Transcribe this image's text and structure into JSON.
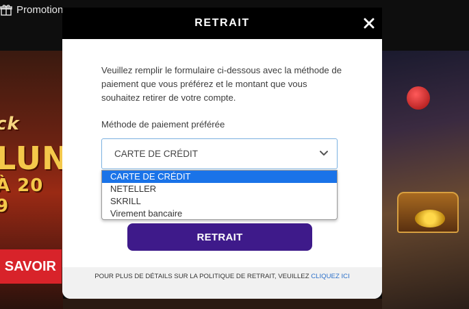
{
  "background": {
    "nav_item": "Promotions",
    "promo_lines": [
      "ck",
      "LUN",
      "À 20 9"
    ],
    "promo_button": "SAVOIR"
  },
  "modal": {
    "title": "RETRAIT",
    "close_icon": "close-icon",
    "intro": "Veuillez remplir le formulaire ci-dessous avec la méthode de paiement que vous préférez et le montant que vous souhaitez retirer de votre compte.",
    "payment_label": "Méthode de paiement préférée",
    "payment_select": {
      "value": "CARTE DE CRÉDIT",
      "options": [
        "CARTE DE CRÉDIT",
        "NETELLER",
        "SKRILL",
        "Virement bancaire"
      ],
      "selected_index": 0
    },
    "submit_label": "RETRAIT",
    "footer": {
      "text": "POUR PLUS DE DÉTAILS SUR LA POLITIQUE DE RETRAIT, VEUILLEZ",
      "link_text": "CLIQUEZ ICI"
    }
  },
  "colors": {
    "header_bg": "#000000",
    "submit_bg": "#3e1a8a",
    "option_selected_bg": "#1a73e8",
    "link": "#2a6fc9"
  }
}
